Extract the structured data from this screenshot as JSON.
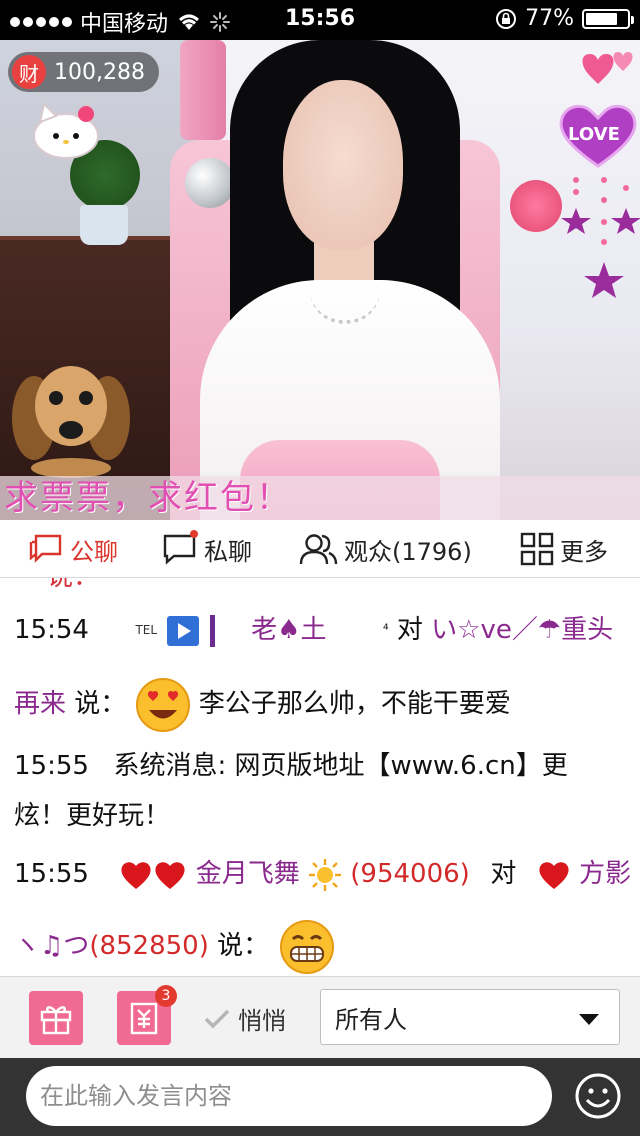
{
  "status_bar": {
    "carrier": "中国移动",
    "time": "15:56",
    "battery": "77%",
    "battery_level": 0.77
  },
  "video": {
    "wealth_badge": "财",
    "wealth_value": "100,288",
    "overlay_text": "求票票，求红包！",
    "love_sticker": "LOVE"
  },
  "tabs": [
    {
      "label": "公聊",
      "icon": "chat-bubble-icon",
      "active": true
    },
    {
      "label": "私聊",
      "icon": "private-chat-icon",
      "active": false,
      "has_dot": true
    },
    {
      "label": "观众(1796)",
      "icon": "audience-icon",
      "active": false
    },
    {
      "label": "更多",
      "icon": "grid-icon",
      "active": false
    }
  ],
  "chat": {
    "cut_top": "    说：",
    "messages": [
      {
        "time": "15:54",
        "tel": "TEL",
        "sender": "老♠土",
        "sup": "⁴",
        "to_word": "对",
        "receiver": "い☆ve／☂重头",
        "receiver_cont": "再来",
        "say": "说：",
        "text": "李公子那么帅，不能干要爱"
      },
      {
        "time": "15:55",
        "label": "系统消息:",
        "text_line1": "网页版地址【www.6.cn】更",
        "text_line2": "炫！更好玩！"
      },
      {
        "time": "15:55",
        "sender": "金月飞舞",
        "sender_id": "(954006)",
        "to_word": "对",
        "receiver": "方影",
        "receiver_cont": "ヽ♫つ",
        "receiver_id": "(852850)",
        "say": "说："
      }
    ]
  },
  "toolbar": {
    "gift_icon": "gift-icon",
    "red_packet_icon": "red-packet-icon",
    "red_packet_count": "3",
    "whisper_label": "悄悄",
    "recipient_value": "所有人"
  },
  "input": {
    "placeholder": "在此输入发言内容"
  },
  "colors": {
    "accent_red": "#d9352d",
    "name_purple": "#8a2a8f",
    "button_pink": "#f06a93"
  }
}
